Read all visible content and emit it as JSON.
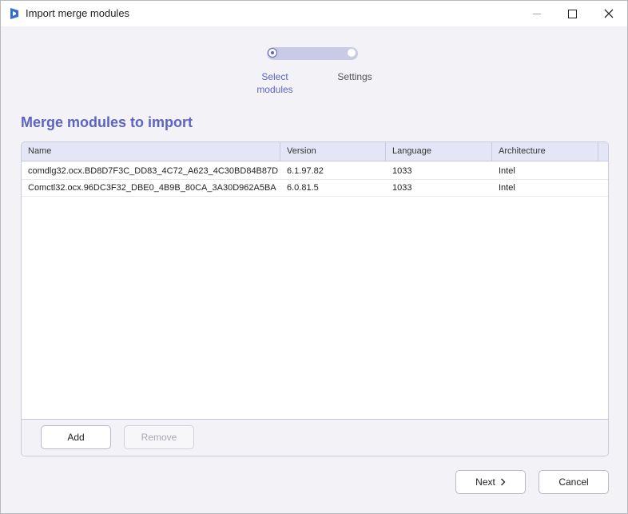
{
  "window": {
    "title": "Import merge modules",
    "app_icon": "installer-app-icon",
    "accent": "#5d63c4"
  },
  "stepper": {
    "steps": [
      {
        "label": "Select\nmodules",
        "active": true
      },
      {
        "label": "Settings",
        "active": false
      }
    ]
  },
  "section": {
    "title": "Merge modules to import"
  },
  "table": {
    "columns": [
      "Name",
      "Version",
      "Language",
      "Architecture"
    ],
    "rows": [
      [
        "comdlg32.ocx.BD8D7F3C_DD83_4C72_A623_4C30BD84B87D",
        "6.1.97.82",
        "1033",
        "Intel"
      ],
      [
        "Comctl32.ocx.96DC3F32_DBE0_4B9B_80CA_3A30D962A5BA",
        "6.0.81.5",
        "1033",
        "Intel"
      ]
    ]
  },
  "grid_buttons": {
    "add": "Add",
    "remove": "Remove"
  },
  "footer": {
    "next": "Next",
    "cancel": "Cancel"
  }
}
